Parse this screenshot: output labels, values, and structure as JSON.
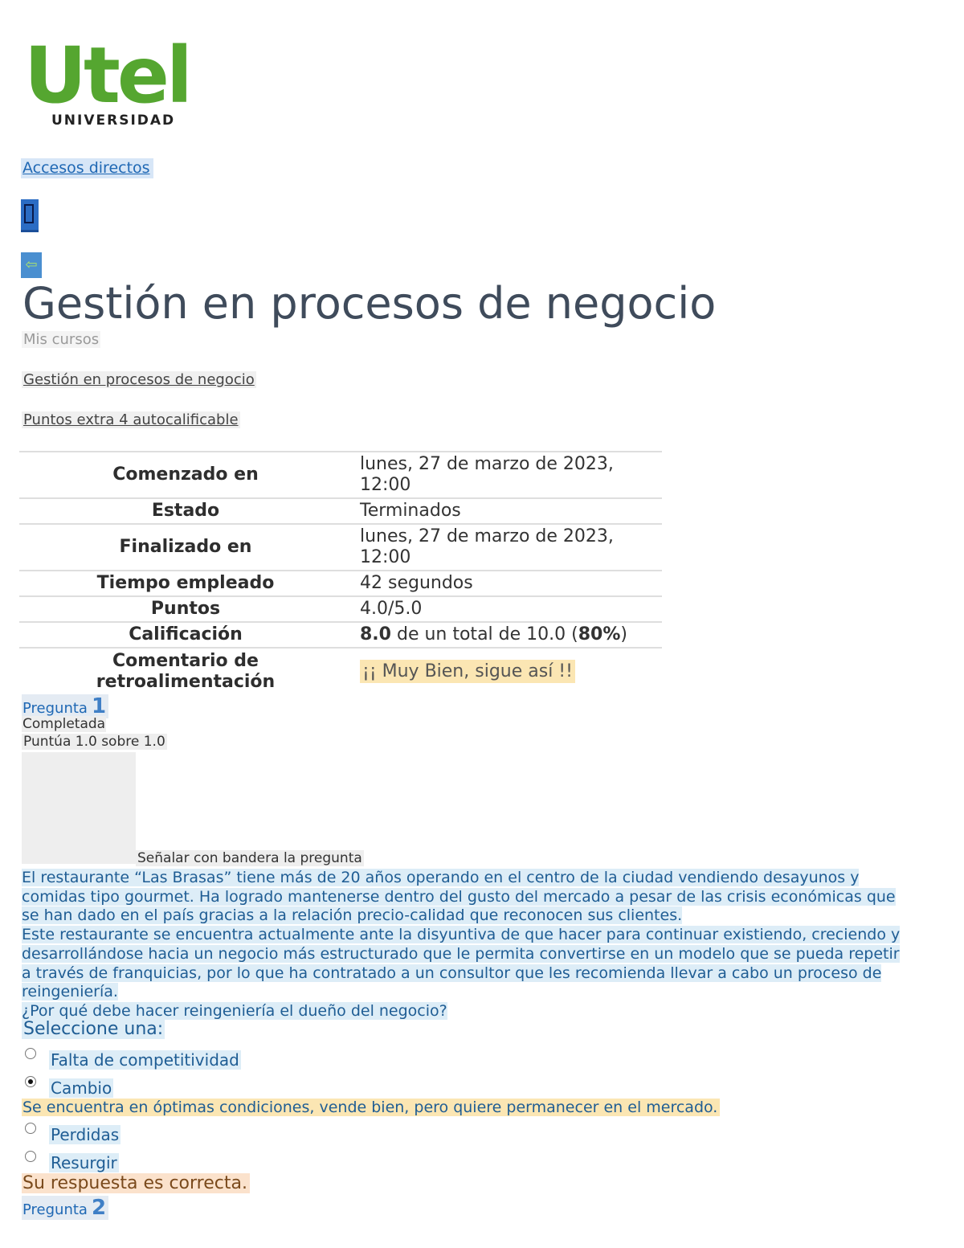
{
  "logo": {
    "word": "Utel",
    "subtitle": "UNIVERSIDAD",
    "brand_color": "#55a630"
  },
  "nav": {
    "shortcuts_label": "Accesos directos",
    "menu_icon": "menu-icon",
    "back_icon": "back-arrow-icon",
    "back_glyph": "⇦"
  },
  "course": {
    "title": "Gestión en procesos de negocio"
  },
  "breadcrumb": {
    "mis_cursos": "Mis cursos",
    "course": "Gestión en procesos de negocio",
    "quiz": "Puntos extra 4 autocalificable"
  },
  "summary": {
    "started_label": "Comenzado en",
    "started_value_1": "lunes, 27 de marzo de 2023,",
    "started_value_2": "12:00",
    "state_label": "Estado",
    "state_value": "Terminados",
    "finished_label": "Finalizado en",
    "finished_value_1": "lunes, 27 de marzo de 2023,",
    "finished_value_2": "12:00",
    "time_label": "Tiempo empleado",
    "time_value": "42 segundos",
    "points_label": "Puntos",
    "points_value": "4.0/5.0",
    "grade_label": "Calificación",
    "grade_score": "8.0",
    "grade_mid": " de un total de 10.0 (",
    "grade_percent": "80%",
    "grade_end": ")",
    "feedback_label_1": "Comentario de",
    "feedback_label_2": "retroalimentación",
    "feedback_value": "¡¡ Muy Bien, sigue así !!"
  },
  "question1": {
    "word": "Pregunta",
    "number": "1",
    "state": "Completada",
    "grade": "Puntúa 1.0 sobre 1.0",
    "flag_label": "Señalar con bandera la pregunta",
    "lines": [
      "El restaurante “Las Brasas” tiene más de 20 años operando en el centro de la ciudad vendiendo desayunos y",
      "comidas tipo gourmet. Ha logrado mantenerse dentro del gusto del mercado a pesar de las crisis económicas que",
      "se han dado en el país gracias a la relación precio-calidad que reconocen sus clientes.",
      "Este restaurante se encuentra actualmente ante la disyuntiva de que hacer para continuar existiendo, creciendo y",
      "desarrollándose hacia un negocio más estructurado que le permita convertirse en un modelo que se pueda repetir",
      "a través de franquicias, por lo que ha contratado a un consultor que les recomienda llevar a cabo un proceso de",
      "reingeniería.",
      "¿Por qué debe hacer reingeniería el dueño del negocio?"
    ],
    "prompt": "Seleccione una:",
    "options": [
      {
        "label": "Falta de competitividad",
        "selected": false
      },
      {
        "label": "Cambio",
        "selected": true
      },
      {
        "label": "Perdidas",
        "selected": false
      },
      {
        "label": "Resurgir",
        "selected": false
      }
    ],
    "option_feedback": "Se encuentra en óptimas condiciones, vende bien, pero quiere permanecer en el mercado.",
    "result": "Su respuesta es correcta."
  },
  "question2": {
    "word": "Pregunta",
    "number": "2"
  },
  "colors": {
    "link": "#1f68b4",
    "highlight_blue": "#ddedf7",
    "highlight_yellow": "#fbe6b3",
    "highlight_orange": "#fbe2cc",
    "title": "#3f4b5b"
  }
}
